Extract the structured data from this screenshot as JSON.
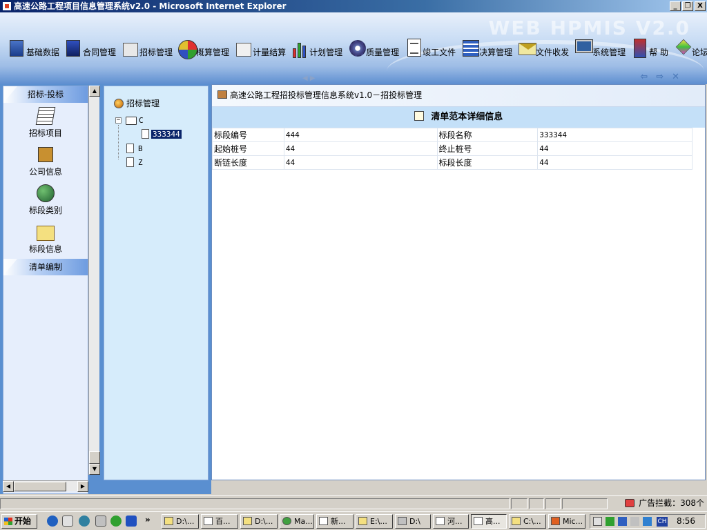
{
  "window": {
    "title": "高速公路工程项目信息管理系统v2.0 - Microsoft Internet Explorer",
    "minimize": "_",
    "restore": "❐",
    "close": "X"
  },
  "banner": {
    "watermark": "WEB HPMIS  V2.0"
  },
  "toolbar": {
    "items": [
      {
        "label": "基础数据",
        "icon": "database-icon"
      },
      {
        "label": "合同管理",
        "icon": "contract-icon"
      },
      {
        "label": "招标管理",
        "icon": "bidding-icon"
      },
      {
        "label": "概算管理",
        "icon": "pie-chart-icon"
      },
      {
        "label": "计量结算",
        "icon": "calculator-icon"
      },
      {
        "label": "计划管理",
        "icon": "bar-chart-icon"
      },
      {
        "label": "质量管理",
        "icon": "gear-icon"
      },
      {
        "label": "竣工文件",
        "icon": "document-icon"
      },
      {
        "label": "决算管理",
        "icon": "spreadsheet-icon"
      },
      {
        "label": "文件收发",
        "icon": "envelope-icon"
      },
      {
        "label": "系统管理",
        "icon": "computer-icon"
      },
      {
        "label": "帮 助",
        "icon": "help-book-icon"
      },
      {
        "label": "论坛",
        "icon": "forum-cube-icon"
      }
    ]
  },
  "sidebar": {
    "section1": "招标-投标",
    "items": [
      {
        "label": "招标项目",
        "icon": "papers-icon"
      },
      {
        "label": "公司信息",
        "icon": "company-icon"
      },
      {
        "label": "标段类别",
        "icon": "globe-chart-icon"
      },
      {
        "label": "标段信息",
        "icon": "folder-cursor-icon"
      }
    ],
    "section2": "清单编制"
  },
  "tree": {
    "root": "招标管理",
    "nodes": [
      {
        "label": "C",
        "expander": "−"
      },
      {
        "label": "333344"
      },
      {
        "label": "B"
      },
      {
        "label": "Z"
      }
    ]
  },
  "main": {
    "breadcrumb": "高速公路工程招投标管理信息系统v1.0－招投标管理",
    "detail_title": "清单范本详细信息",
    "rows": [
      {
        "l1": "标段编号",
        "v1": "444",
        "l2": "标段名称",
        "v2": "333344"
      },
      {
        "l1": "起始桩号",
        "v1": "44",
        "l2": "终止桩号",
        "v2": "44"
      },
      {
        "l1": "断链长度",
        "v1": "44",
        "l2": "标段长度",
        "v2": "44"
      }
    ]
  },
  "statusbar": {
    "adblock": "广告拦截：308个"
  },
  "taskbar": {
    "start": "开始",
    "more": "»",
    "tasks": [
      {
        "label": "D:\\..."
      },
      {
        "label": "百..."
      },
      {
        "label": "D:\\..."
      },
      {
        "label": "Ma..."
      },
      {
        "label": "新..."
      },
      {
        "label": "E:\\..."
      },
      {
        "label": "D:\\"
      },
      {
        "label": "河..."
      },
      {
        "label": "高..."
      },
      {
        "label": "C:\\..."
      },
      {
        "label": "Mic..."
      }
    ],
    "input_lang": "CH",
    "clock": "8:56"
  }
}
